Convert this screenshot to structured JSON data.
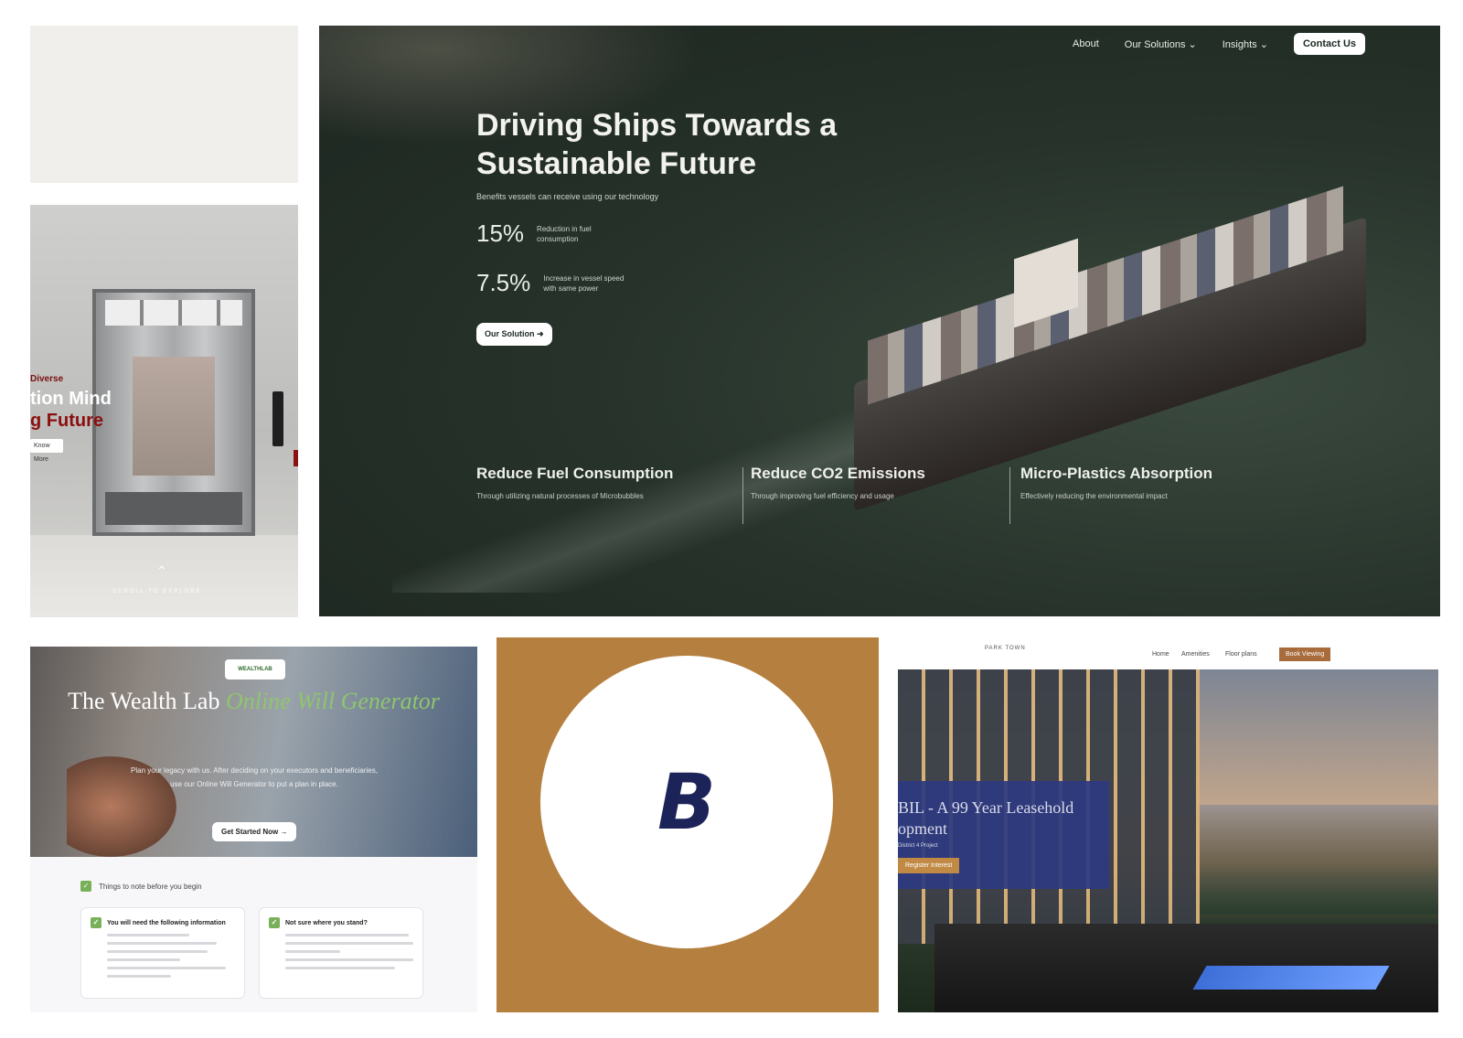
{
  "elevator": {
    "kicker": "Diverse",
    "headline_1": "tion Mind",
    "headline_2": "g Future",
    "button": "Know More",
    "scroll": "SCROLL TO EXPLORE"
  },
  "ship": {
    "nav": [
      "About",
      "Our Solutions",
      "Insights"
    ],
    "cta": "Contact Us",
    "headline": "Driving Ships Towards a Sustainable Future",
    "sub": "Benefits vessels can receive using our technology",
    "stats": [
      {
        "value": "15%",
        "label": "Reduction in fuel consumption"
      },
      {
        "value": "7.5%",
        "label": "Increase in vessel speed with same power"
      }
    ],
    "solution_button": "Our Solution",
    "features": [
      {
        "title": "Reduce Fuel Consumption",
        "desc": "Through utilizing natural processes of Microbubbles"
      },
      {
        "title": "Reduce CO2 Emissions",
        "desc": "Through improving fuel efficiency and usage"
      },
      {
        "title": "Micro-Plastics Absorption",
        "desc": "Effectively reducing the environmental impact"
      }
    ]
  },
  "wealth": {
    "logo": "WEALTHLAB",
    "title_a": "The Wealth Lab ",
    "title_b": "Online Will Generator",
    "desc": "Plan your legacy with us. After deciding on your executors and beneficiaries, use our Online Will Generator to put a plan in place.",
    "button": "Get Started Now →",
    "note": "Things to note before you begin",
    "card1": "You will need the following information",
    "card2": "Not sure where you stand?"
  },
  "brand": {
    "mark": "B"
  },
  "condo": {
    "logo": "PARK TOWN",
    "nav": [
      "Home",
      "Amenities",
      "Floor plans"
    ],
    "book": "Book Viewing",
    "headline_1": "BIL - A 99 Year Leasehold",
    "headline_2": "opment",
    "sub": "District 4 Project",
    "button": "Register Interest"
  }
}
